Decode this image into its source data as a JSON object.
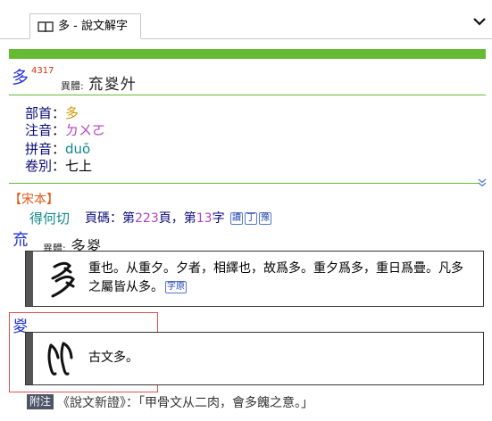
{
  "tab": {
    "title": "多 - 說文解字",
    "icon": "book-icon"
  },
  "entry": {
    "character": "多",
    "code": "4317",
    "variant_label": "異體:",
    "variants": "㐬㚇㚈"
  },
  "fields": [
    {
      "label": "部首",
      "value": "多",
      "color": "#d19a00"
    },
    {
      "label": "注音",
      "value": "ㄉㄨㄛ",
      "color": "#b040c0"
    },
    {
      "label": "拼音",
      "value": "duō",
      "color": "#10888a"
    },
    {
      "label": "卷別",
      "value": "七上",
      "color": "#000000"
    }
  ],
  "songben": {
    "header": "【宋本】",
    "fanqie": "得何切",
    "page_prefix": "頁碼：第",
    "page_num": "223",
    "page_mid": "頁，第",
    "char_num": "13",
    "page_suffix": "字",
    "tags": [
      "讀",
      "丁",
      "豫"
    ]
  },
  "section1": {
    "head_char": "㐬",
    "variant_label": "異體:",
    "variants": "多㚇",
    "definition": "重也。从重夕。夕者，相繹也，故爲多。重夕爲多，重日爲疊。凡多之屬皆从多。",
    "tag": "字原"
  },
  "section2": {
    "head_char": "㚇",
    "definition": "古文多。"
  },
  "note": {
    "label": "附注",
    "text": "《說文新證》：「甲骨文从二肉，會多餽之意。」"
  },
  "colors": {
    "green": "#66bb33",
    "blue": "#2233cc",
    "orange": "#e0591a",
    "red_box": "#e15050"
  }
}
